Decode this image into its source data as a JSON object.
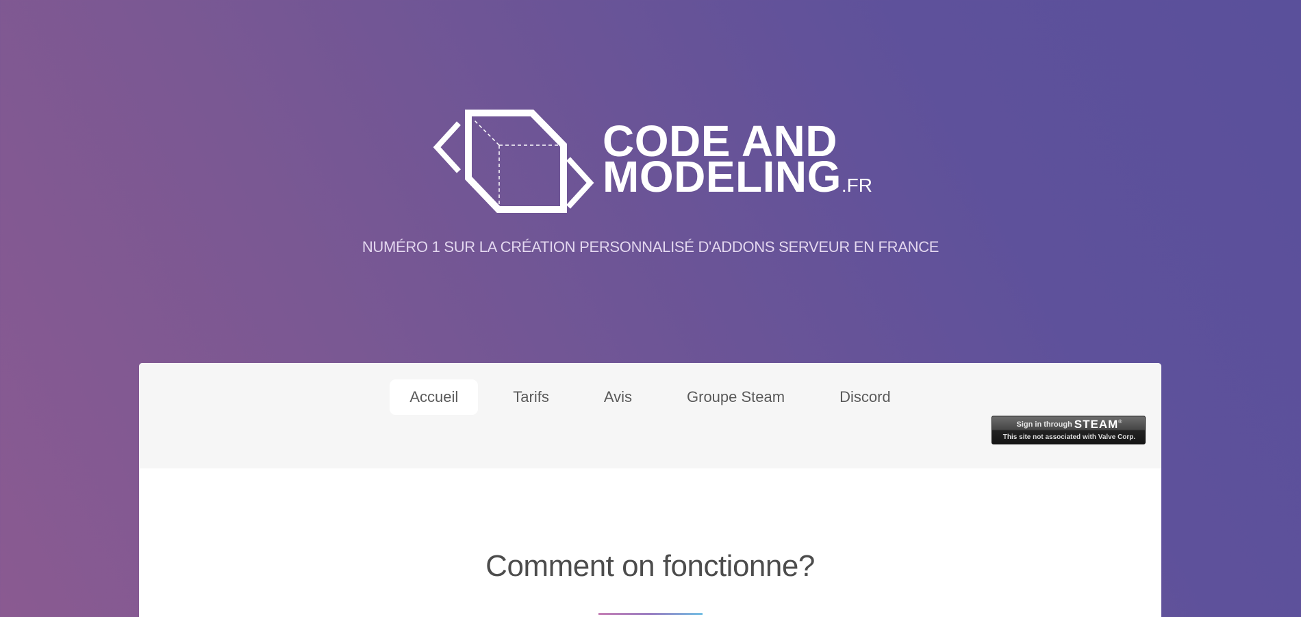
{
  "brand": {
    "name_line1": "CODE AND",
    "name_line2": "MODELING",
    "tld": ".FR",
    "logo_icon": "cube-in-code-brackets-icon",
    "tagline": "NUMÉRO 1 SUR LA CRÉATION PERSONNALISÉ D'ADDONS SERVEUR EN FRANCE"
  },
  "nav": {
    "items": [
      {
        "label": "Accueil",
        "active": true
      },
      {
        "label": "Tarifs",
        "active": false
      },
      {
        "label": "Avis",
        "active": false
      },
      {
        "label": "Groupe Steam",
        "active": false
      },
      {
        "label": "Discord",
        "active": false
      }
    ]
  },
  "steam_login": {
    "top_small": "Sign in through",
    "top_big": "STEAM",
    "registered_mark": "®",
    "bottom": "This site not associated with Valve Corp."
  },
  "section": {
    "title": "Comment on fonctionne?"
  },
  "colors": {
    "background_gradient_start": "#8a5a91",
    "background_gradient_end": "#5a509b",
    "panel": "#ffffff",
    "navbar": "#f6f6f6",
    "underline_start": "#c57fb5",
    "underline_end": "#74bfe4"
  }
}
